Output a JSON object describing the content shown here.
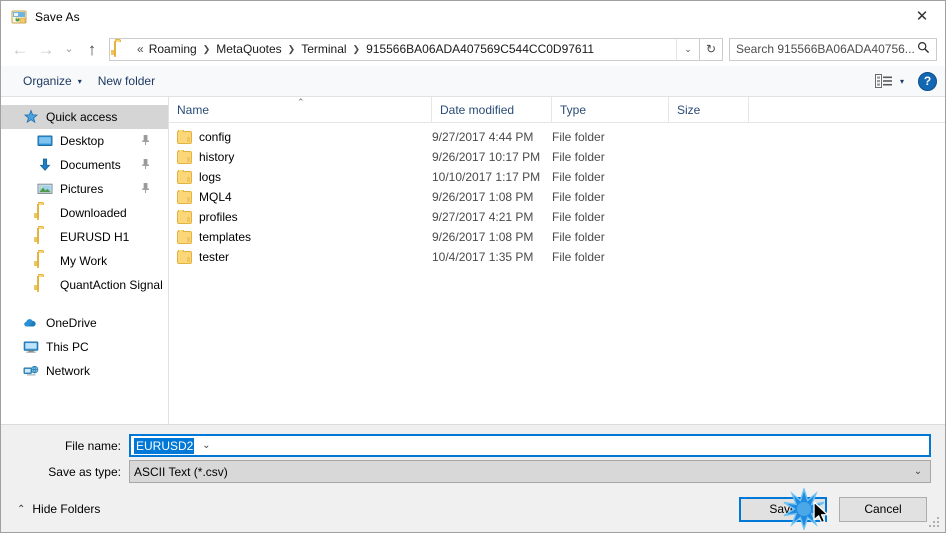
{
  "window": {
    "title": "Save As",
    "icon": "save-as-icon",
    "close_label": "✕"
  },
  "nav": {
    "back_icon": "←",
    "forward_icon": "→",
    "recent_icon": "⌄",
    "up_icon": "↑",
    "refresh_icon": "↻",
    "breadcrumb_prefix": "«",
    "separator": "❯",
    "dropdown_icon": "⌄",
    "crumbs": [
      "Roaming",
      "MetaQuotes",
      "Terminal",
      "915566BA06ADA407569C544CC0D97611"
    ]
  },
  "search": {
    "placeholder": "Search 915566BA06ADA40756...",
    "icon": "🔍"
  },
  "toolbar": {
    "organize_label": "Organize",
    "organize_caret": "▾",
    "new_folder_label": "New folder",
    "view_caret": "▾",
    "help_label": "?"
  },
  "sidebar": {
    "items": [
      {
        "label": "Quick access",
        "icon": "star-icon",
        "selected": true,
        "indent": false,
        "pinned": false
      },
      {
        "label": "Desktop",
        "icon": "desktop-icon",
        "selected": false,
        "indent": true,
        "pinned": true
      },
      {
        "label": "Documents",
        "icon": "documents-icon",
        "selected": false,
        "indent": true,
        "pinned": true
      },
      {
        "label": "Pictures",
        "icon": "pictures-icon",
        "selected": false,
        "indent": true,
        "pinned": true
      },
      {
        "label": "Downloaded",
        "icon": "folder-icon",
        "selected": false,
        "indent": true,
        "pinned": false
      },
      {
        "label": "EURUSD H1",
        "icon": "folder-icon",
        "selected": false,
        "indent": true,
        "pinned": false
      },
      {
        "label": "My Work",
        "icon": "folder-icon",
        "selected": false,
        "indent": true,
        "pinned": false
      },
      {
        "label": "QuantAction Signal",
        "icon": "folder-icon",
        "selected": false,
        "indent": true,
        "pinned": false
      },
      {
        "label": "",
        "icon": "spacer",
        "selected": false,
        "indent": false,
        "pinned": false
      },
      {
        "label": "OneDrive",
        "icon": "onedrive-icon",
        "selected": false,
        "indent": false,
        "pinned": false
      },
      {
        "label": "This PC",
        "icon": "thispc-icon",
        "selected": false,
        "indent": false,
        "pinned": false
      },
      {
        "label": "Network",
        "icon": "network-icon",
        "selected": false,
        "indent": false,
        "pinned": false
      }
    ],
    "pin_icon": "📌"
  },
  "filelist": {
    "columns": [
      "Name",
      "Date modified",
      "Type",
      "Size"
    ],
    "sort_caret": "⌃",
    "rows": [
      {
        "name": "config",
        "date": "9/27/2017 4:44 PM",
        "type": "File folder",
        "size": ""
      },
      {
        "name": "history",
        "date": "9/26/2017 10:17 PM",
        "type": "File folder",
        "size": ""
      },
      {
        "name": "logs",
        "date": "10/10/2017 1:17 PM",
        "type": "File folder",
        "size": ""
      },
      {
        "name": "MQL4",
        "date": "9/26/2017 1:08 PM",
        "type": "File folder",
        "size": ""
      },
      {
        "name": "profiles",
        "date": "9/27/2017 4:21 PM",
        "type": "File folder",
        "size": ""
      },
      {
        "name": "templates",
        "date": "9/26/2017 1:08 PM",
        "type": "File folder",
        "size": ""
      },
      {
        "name": "tester",
        "date": "10/4/2017 1:35 PM",
        "type": "File folder",
        "size": ""
      }
    ]
  },
  "form": {
    "filename_label": "File name:",
    "filename_value": "EURUSD2",
    "filetype_label": "Save as type:",
    "filetype_value": "ASCII Text (*.csv)",
    "chevron": "⌄"
  },
  "footer": {
    "hide_folders_label": "Hide Folders",
    "hide_folders_caret": "⌃",
    "save_label": "Save",
    "cancel_label": "Cancel"
  },
  "colors": {
    "accent": "#0078d7",
    "folder_yellow": "#fcd77a",
    "help_blue": "#1268b3",
    "selection_blue": "#0078d7",
    "sidebar_selected": "#d5d5d5"
  }
}
